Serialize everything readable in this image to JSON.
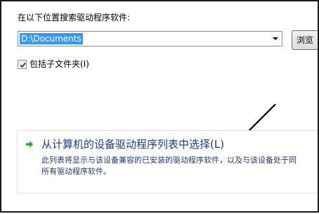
{
  "search": {
    "label": "在以下位置搜索驱动程序软件:",
    "path_value": "D:\\Documents",
    "browse_label": "浏览"
  },
  "include_subfolders": {
    "label": "包括子文件夹(I)",
    "checked": true
  },
  "pick_option": {
    "title": "从计算机的设备驱动程序列表中选择(L)",
    "description_line1": "此列表将显示与该设备兼容的已安装的驱动程序软件，以及与该设备处于同",
    "description_line2": "所有驱动程序软件。"
  },
  "icons": {
    "dropdown": "chevron-down-icon",
    "checkbox": "checkmark-icon",
    "option": "green-arrow-icon",
    "annotation": "annotation-arrow-icon"
  },
  "colors": {
    "selection": "#3399ff",
    "option_title": "#1a3c8a",
    "option_text": "#1f3b78",
    "green_arrow": "#2aa12a"
  }
}
